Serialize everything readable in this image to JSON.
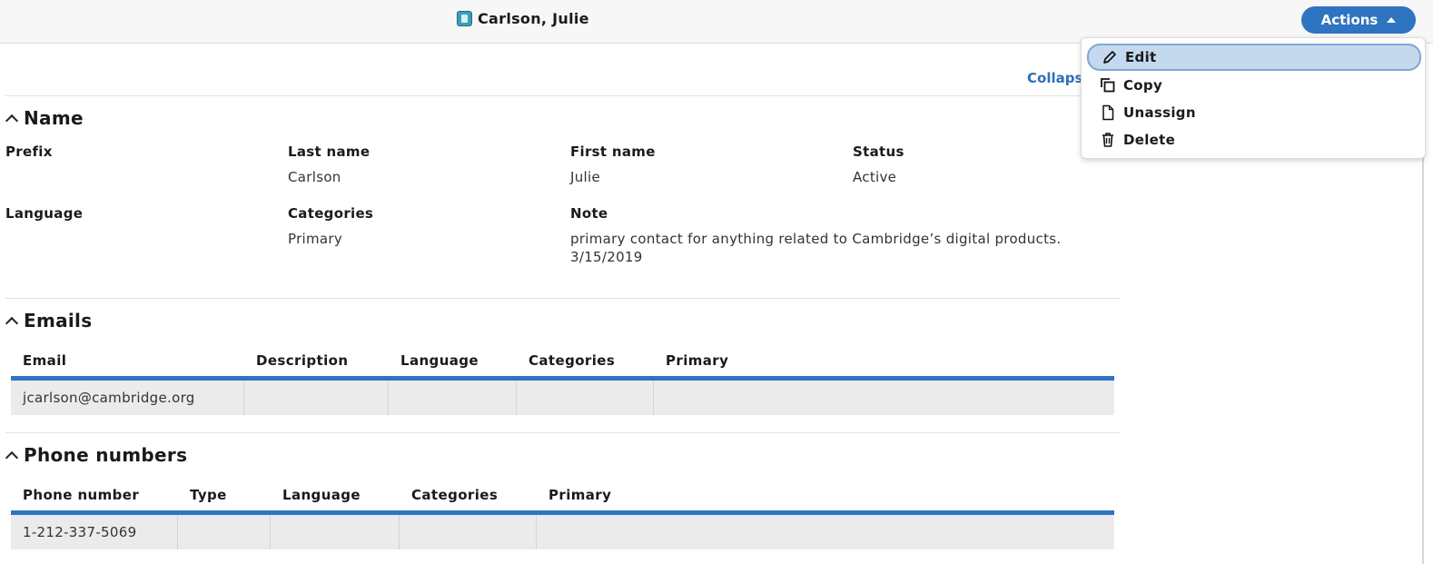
{
  "header": {
    "title": "Carlson, Julie",
    "actions_label": "Actions"
  },
  "collapse_label": "Collapse all",
  "name_section": {
    "title": "Name",
    "fields": {
      "prefix": {
        "label": "Prefix",
        "value": ""
      },
      "last_name": {
        "label": "Last name",
        "value": "Carlson"
      },
      "first_name": {
        "label": "First name",
        "value": "Julie"
      },
      "status": {
        "label": "Status",
        "value": "Active"
      },
      "language": {
        "label": "Language",
        "value": ""
      },
      "categories": {
        "label": "Categories",
        "value": "Primary"
      },
      "note": {
        "label": "Note",
        "line1": "primary contact for anything related to Cambridge’s digital products.",
        "line2": "3/15/2019"
      }
    }
  },
  "emails_section": {
    "title": "Emails",
    "columns": [
      "Email",
      "Description",
      "Language",
      "Categories",
      "Primary"
    ],
    "rows": [
      [
        "jcarlson@cambridge.org",
        "",
        "",
        "",
        ""
      ]
    ]
  },
  "phones_section": {
    "title": "Phone numbers",
    "columns": [
      "Phone number",
      "Type",
      "Language",
      "Categories",
      "Primary"
    ],
    "rows": [
      [
        "1-212-337-5069",
        "",
        "",
        "",
        ""
      ]
    ]
  },
  "actions_menu": {
    "items": [
      {
        "label": "Edit",
        "icon": "pencil-icon"
      },
      {
        "label": "Copy",
        "icon": "copy-icon"
      },
      {
        "label": "Unassign",
        "icon": "document-icon"
      },
      {
        "label": "Delete",
        "icon": "trash-icon"
      }
    ]
  },
  "colors": {
    "accent": "#2f74c0",
    "link": "#2f6fb5",
    "row_bg": "#ebebeb"
  }
}
